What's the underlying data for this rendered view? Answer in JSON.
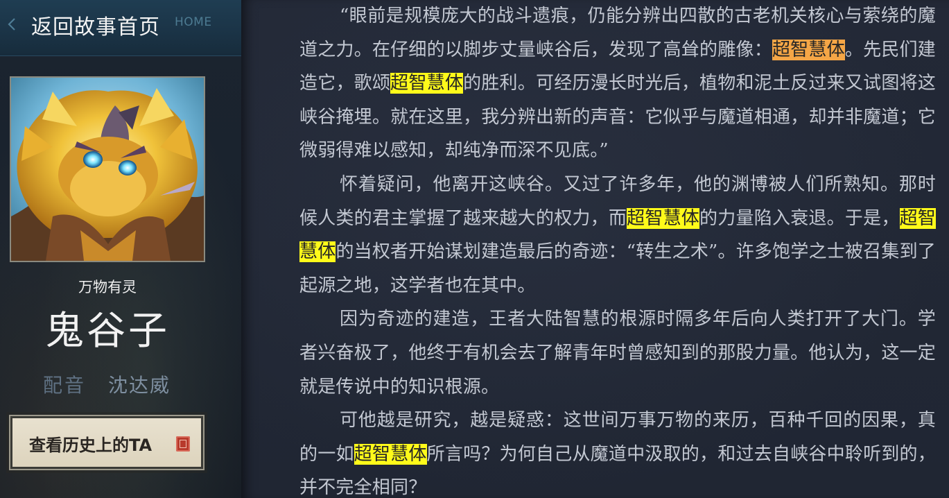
{
  "nav": {
    "back_label": "返回故事首页",
    "home_label": "HOME"
  },
  "hero": {
    "category": "万物有灵",
    "name": "鬼谷子",
    "voice_label": "配音",
    "voice_actor": "沈达威",
    "history_button_label": "查看历史上的TA"
  },
  "highlight_term": "超智慧体",
  "highlight_colors": {
    "current": "#f5a646",
    "match": "#fffa1a"
  },
  "story": {
    "paragraphs": [
      [
        {
          "text": "“眼前是规模庞大的战斗遗痕，仍能分辨出四散的古老机关核心与萦绕的魔道之力。在仔细的以脚步丈量峡谷后，发现了高耸的雕像："
        },
        {
          "text": "超智慧体",
          "highlight": "current"
        },
        {
          "text": "。先民们建造它，歌颂"
        },
        {
          "text": "超智慧体",
          "highlight": "match"
        },
        {
          "text": "的胜利。可经历漫长时光后，植物和泥土反过来又试图将这峡谷掩埋。就在这里，我分辨出新的声音：它似乎与魔道相通，却并非魔道；它微弱得难以感知，却纯净而深不见底。”"
        }
      ],
      [
        {
          "text": "怀着疑问，他离开这峡谷。又过了许多年，他的渊博被人们所熟知。那时候人类的君主掌握了越来越大的权力，而"
        },
        {
          "text": "超智慧体",
          "highlight": "match"
        },
        {
          "text": "的力量陷入衰退。于是，"
        },
        {
          "text": "超智慧体",
          "highlight": "match"
        },
        {
          "text": "的当权者开始谋划建造最后的奇迹：“转生之术”。许多饱学之士被召集到了起源之地，这学者也在其中。"
        }
      ],
      [
        {
          "text": "因为奇迹的建造，王者大陆智慧的根源时隔多年后向人类打开了大门。学者兴奋极了，他终于有机会去了解青年时曾感知到的那股力量。他认为，这一定就是传说中的知识根源。"
        }
      ],
      [
        {
          "text": "可他越是研究，越是疑惑：这世间万事万物的来历，百种千回的因果，真的一如"
        },
        {
          "text": "超智慧体",
          "highlight": "match"
        },
        {
          "text": "所言吗？为何自己从魔道中汲取的，和过去自峡谷中聆听到的，并不完全相同？"
        }
      ]
    ]
  }
}
